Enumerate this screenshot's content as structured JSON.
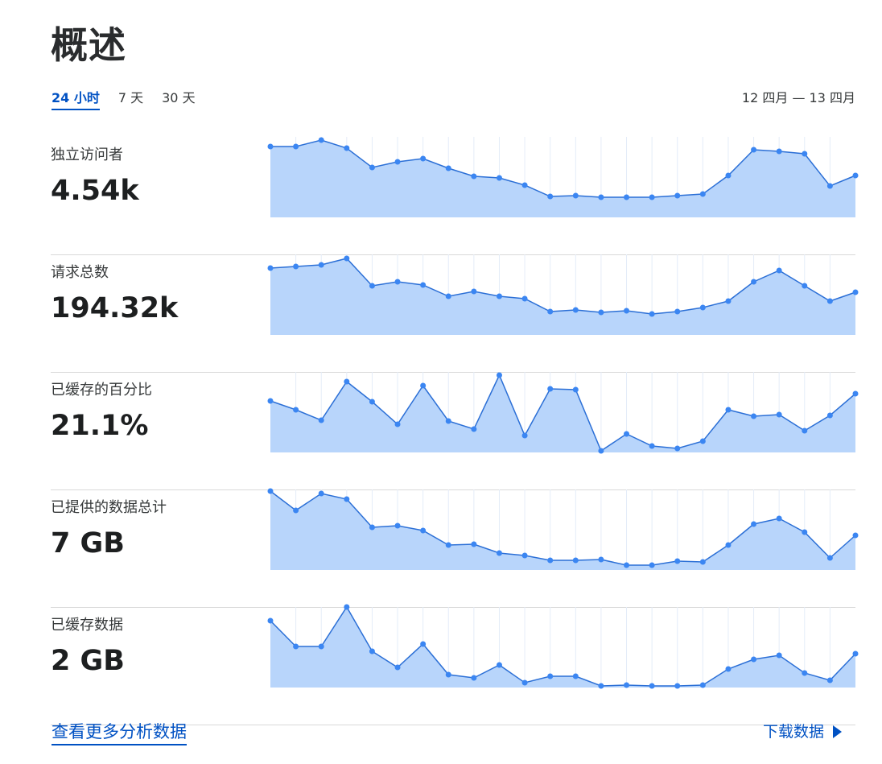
{
  "page": {
    "title": "概述"
  },
  "range_tabs": [
    {
      "label": "24 小时",
      "active": true
    },
    {
      "label": "7 天",
      "active": false
    },
    {
      "label": "30 天",
      "active": false
    }
  ],
  "date_range": "12 四月 — 13 四月",
  "colors": {
    "line": "#2b6fd6",
    "point": "#3b86f2",
    "fill": "#b8d5fb",
    "grid": "#e4ecf8",
    "link": "#0051c3"
  },
  "metrics": [
    {
      "label": "独立访问者",
      "value": "4.54k"
    },
    {
      "label": "请求总数",
      "value": "194.32k"
    },
    {
      "label": "已缓存的百分比",
      "value": "21.1%"
    },
    {
      "label": "已提供的数据总计",
      "value": "7 GB"
    },
    {
      "label": "已缓存数据",
      "value": "2 GB"
    }
  ],
  "chart_data": [
    {
      "type": "area",
      "title": "独立访问者",
      "x": [
        0,
        1,
        2,
        3,
        4,
        5,
        6,
        7,
        8,
        9,
        10,
        11,
        12,
        13,
        14,
        15,
        16,
        17,
        18,
        19,
        20,
        21,
        22,
        23
      ],
      "values": [
        0.88,
        0.88,
        0.96,
        0.86,
        0.62,
        0.69,
        0.73,
        0.61,
        0.51,
        0.49,
        0.4,
        0.26,
        0.27,
        0.25,
        0.25,
        0.25,
        0.27,
        0.29,
        0.52,
        0.84,
        0.82,
        0.79,
        0.39,
        0.52
      ]
    },
    {
      "type": "area",
      "title": "请求总数",
      "x": [
        0,
        1,
        2,
        3,
        4,
        5,
        6,
        7,
        8,
        9,
        10,
        11,
        12,
        13,
        14,
        15,
        16,
        17,
        18,
        19,
        20,
        21,
        22,
        23
      ],
      "values": [
        0.83,
        0.85,
        0.87,
        0.95,
        0.61,
        0.66,
        0.62,
        0.48,
        0.54,
        0.48,
        0.45,
        0.29,
        0.31,
        0.28,
        0.3,
        0.26,
        0.29,
        0.34,
        0.42,
        0.66,
        0.8,
        0.61,
        0.42,
        0.53
      ]
    },
    {
      "type": "area",
      "title": "已缓存的百分比",
      "x": [
        0,
        1,
        2,
        3,
        4,
        5,
        6,
        7,
        8,
        9,
        10,
        11,
        12,
        13,
        14,
        15,
        16,
        17,
        18,
        19,
        20,
        21,
        22,
        23
      ],
      "values": [
        0.64,
        0.53,
        0.4,
        0.88,
        0.63,
        0.35,
        0.83,
        0.39,
        0.29,
        0.96,
        0.21,
        0.79,
        0.78,
        0.02,
        0.23,
        0.08,
        0.05,
        0.14,
        0.53,
        0.45,
        0.47,
        0.27,
        0.46,
        0.73
      ]
    },
    {
      "type": "area",
      "title": "已提供的数据总计",
      "x": [
        0,
        1,
        2,
        3,
        4,
        5,
        6,
        7,
        8,
        9,
        10,
        11,
        12,
        13,
        14,
        15,
        16,
        17,
        18,
        19,
        20,
        21,
        22,
        23
      ],
      "values": [
        0.98,
        0.74,
        0.95,
        0.88,
        0.53,
        0.55,
        0.49,
        0.31,
        0.32,
        0.21,
        0.18,
        0.12,
        0.12,
        0.13,
        0.06,
        0.06,
        0.11,
        0.1,
        0.31,
        0.57,
        0.64,
        0.47,
        0.15,
        0.43
      ]
    },
    {
      "type": "area",
      "title": "已缓存数据",
      "x": [
        0,
        1,
        2,
        3,
        4,
        5,
        6,
        7,
        8,
        9,
        10,
        11,
        12,
        13,
        14,
        15,
        16,
        17,
        18,
        19,
        20,
        21,
        22,
        23
      ],
      "values": [
        0.83,
        0.51,
        0.51,
        1.0,
        0.45,
        0.25,
        0.54,
        0.16,
        0.12,
        0.28,
        0.06,
        0.14,
        0.14,
        0.02,
        0.03,
        0.02,
        0.02,
        0.03,
        0.23,
        0.35,
        0.4,
        0.18,
        0.09,
        0.42
      ]
    }
  ],
  "footer": {
    "more_link": "查看更多分析数据",
    "download": "下载数据"
  }
}
